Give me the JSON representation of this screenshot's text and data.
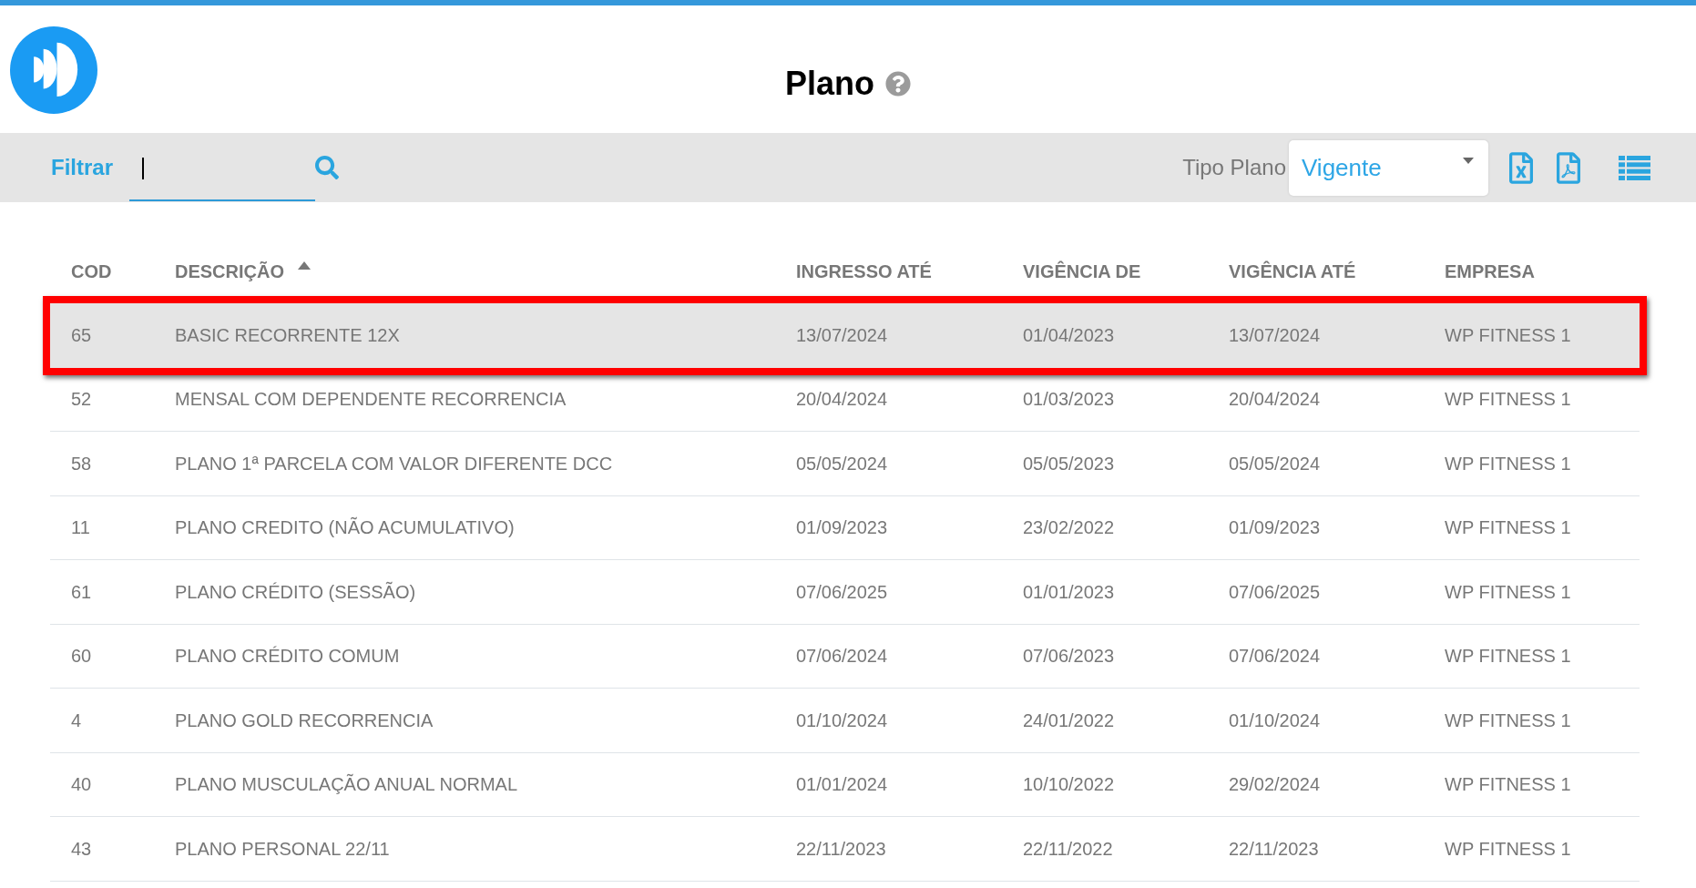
{
  "title": "Plano",
  "toolbar": {
    "filter": {
      "label": "Filtrar",
      "focused": true
    },
    "plan_type": {
      "label": "Tipo Plano",
      "value": "Vigente"
    }
  },
  "table": {
    "columns": [
      {
        "label": "COD",
        "sorted": false
      },
      {
        "label": "DESCRIÇÃO",
        "sorted": true
      },
      {
        "label": "INGRESSO ATÉ",
        "sorted": false
      },
      {
        "label": "VIGÊNCIA DE",
        "sorted": false
      },
      {
        "label": "VIGÊNCIA ATÉ",
        "sorted": false
      },
      {
        "label": "EMPRESA",
        "sorted": false
      }
    ],
    "rows": [
      {
        "selected": true,
        "cells": [
          "65",
          "BASIC RECORRENTE 12X",
          "13/07/2024",
          "01/04/2023",
          "13/07/2024",
          "WP FITNESS 1"
        ]
      },
      {
        "selected": false,
        "cells": [
          "52",
          "MENSAL COM DEPENDENTE RECORRENCIA",
          "20/04/2024",
          "01/03/2023",
          "20/04/2024",
          "WP FITNESS 1"
        ]
      },
      {
        "selected": false,
        "cells": [
          "58",
          "PLANO 1ª PARCELA COM VALOR DIFERENTE DCC",
          "05/05/2024",
          "05/05/2023",
          "05/05/2024",
          "WP FITNESS 1"
        ]
      },
      {
        "selected": false,
        "cells": [
          "11",
          "PLANO CREDITO (NÃO ACUMULATIVO)",
          "01/09/2023",
          "23/02/2022",
          "01/09/2023",
          "WP FITNESS 1"
        ]
      },
      {
        "selected": false,
        "cells": [
          "61",
          "PLANO CRÉDITO (SESSÃO)",
          "07/06/2025",
          "01/01/2023",
          "07/06/2025",
          "WP FITNESS 1"
        ]
      },
      {
        "selected": false,
        "cells": [
          "60",
          "PLANO CRÉDITO COMUM",
          "07/06/2024",
          "07/06/2023",
          "07/06/2024",
          "WP FITNESS 1"
        ]
      },
      {
        "selected": false,
        "cells": [
          "4",
          "PLANO GOLD RECORRENCIA",
          "01/10/2024",
          "24/01/2022",
          "01/10/2024",
          "WP FITNESS 1"
        ]
      },
      {
        "selected": false,
        "cells": [
          "40",
          "PLANO MUSCULAÇÃO ANUAL NORMAL",
          "01/01/2024",
          "10/10/2022",
          "29/02/2024",
          "WP FITNESS 1"
        ]
      },
      {
        "selected": false,
        "cells": [
          "43",
          "PLANO PERSONAL 22/11",
          "22/11/2023",
          "22/11/2022",
          "22/11/2023",
          "WP FITNESS 1"
        ]
      }
    ]
  }
}
